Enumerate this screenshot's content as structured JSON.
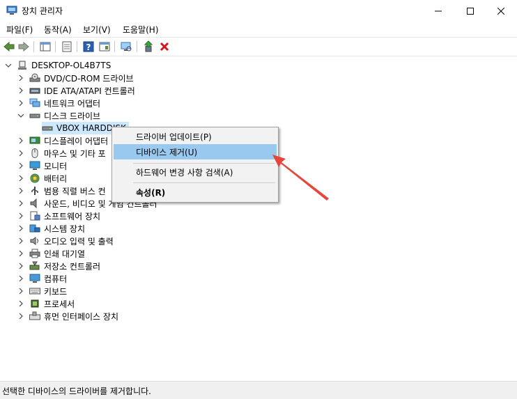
{
  "window": {
    "title": "장치 관리자"
  },
  "menu": {
    "file": "파일(F)",
    "action": "동작(A)",
    "view": "보기(V)",
    "help": "도움말(H)"
  },
  "tree": {
    "root": "DESKTOP-OL4B7TS",
    "items": [
      {
        "label": "DVD/CD-ROM 드라이브",
        "icon": "dvd-drive-icon"
      },
      {
        "label": "IDE ATA/ATAPI 컨트롤러",
        "icon": "ide-controller-icon"
      },
      {
        "label": "네트워크 어댑터",
        "icon": "network-adapter-icon"
      },
      {
        "label": "디스크 드라이브",
        "icon": "disk-drive-icon",
        "expanded": true
      },
      {
        "label": "VBOX HARDDISK",
        "icon": "disk-drive-icon",
        "child": true,
        "selected": true
      },
      {
        "label": "디스플레이 어댑터",
        "icon": "display-adapter-icon"
      },
      {
        "label": "마우스 및 기타 포",
        "icon": "mouse-icon"
      },
      {
        "label": "모니터",
        "icon": "monitor-icon"
      },
      {
        "label": "배터리",
        "icon": "battery-icon"
      },
      {
        "label": "범용 직렬 버스 컨",
        "icon": "usb-icon"
      },
      {
        "label": "사운드, 비디오 및 게임 컨트롤러",
        "icon": "speaker-icon"
      },
      {
        "label": "소프트웨어 장치",
        "icon": "software-device-icon"
      },
      {
        "label": "시스템 장치",
        "icon": "system-device-icon"
      },
      {
        "label": "오디오 입력 및 출력",
        "icon": "audio-io-icon"
      },
      {
        "label": "인쇄 대기열",
        "icon": "printer-icon"
      },
      {
        "label": "저장소 컨트롤러",
        "icon": "storage-controller-icon"
      },
      {
        "label": "컴퓨터",
        "icon": "computer-icon"
      },
      {
        "label": "키보드",
        "icon": "keyboard-icon"
      },
      {
        "label": "프로세서",
        "icon": "processor-icon"
      },
      {
        "label": "휴먼 인터페이스 장치",
        "icon": "hid-icon"
      }
    ]
  },
  "context_menu": {
    "update_driver": "드라이버 업데이트(P)",
    "uninstall_device": "디바이스 제거(U)",
    "scan_hardware": "하드웨어 변경 사항 검색(A)",
    "properties": "속성(R)"
  },
  "status": "선택한 디바이스의 드라이버를 제거합니다.",
  "colors": {
    "selection": "#cce8ff",
    "menu_highlight": "#99c9ef",
    "annotation_arrow": "#e8463c"
  }
}
